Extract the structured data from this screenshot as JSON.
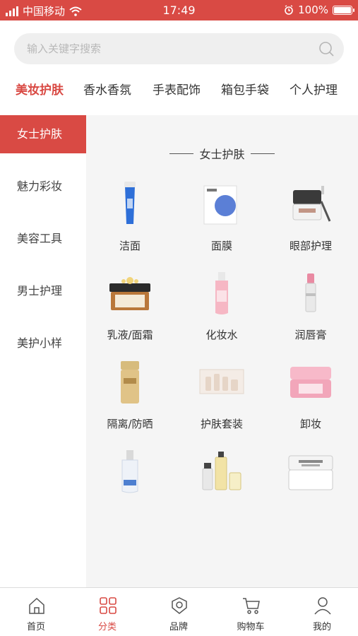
{
  "status_bar": {
    "carrier": "中国移动",
    "time": "17:49",
    "battery": "100%"
  },
  "search": {
    "placeholder": "输入关键字搜索"
  },
  "top_tabs": [
    {
      "label": "美妆护肤",
      "active": true
    },
    {
      "label": "香水香氛",
      "active": false
    },
    {
      "label": "手表配饰",
      "active": false
    },
    {
      "label": "箱包手袋",
      "active": false
    },
    {
      "label": "个人护理",
      "active": false
    }
  ],
  "sidebar": {
    "items": [
      {
        "label": "女士护肤",
        "active": true
      },
      {
        "label": "魅力彩妆",
        "active": false
      },
      {
        "label": "美容工具",
        "active": false
      },
      {
        "label": "男士护理",
        "active": false
      },
      {
        "label": "美护小样",
        "active": false
      }
    ]
  },
  "content": {
    "section_title": "女士护肤",
    "categories": [
      {
        "label": "洁面",
        "icon": "cleanser-tube-icon"
      },
      {
        "label": "面膜",
        "icon": "face-mask-icon"
      },
      {
        "label": "眼部护理",
        "icon": "eye-cream-jar-icon"
      },
      {
        "label": "乳液/面霜",
        "icon": "cream-jar-icon"
      },
      {
        "label": "化妆水",
        "icon": "toner-bottle-icon"
      },
      {
        "label": "润唇膏",
        "icon": "lip-balm-icon"
      },
      {
        "label": "隔离/防晒",
        "icon": "sunscreen-bottle-icon"
      },
      {
        "label": "护肤套装",
        "icon": "skincare-set-icon"
      },
      {
        "label": "卸妆",
        "icon": "makeup-remover-jar-icon"
      },
      {
        "label": "",
        "icon": "serum-bottle-icon"
      },
      {
        "label": "",
        "icon": "skincare-bottles-set-icon"
      },
      {
        "label": "",
        "icon": "face-cream-jar-icon"
      }
    ]
  },
  "bottom_nav": [
    {
      "label": "首页",
      "icon": "home-icon",
      "active": false
    },
    {
      "label": "分类",
      "icon": "category-grid-icon",
      "active": true
    },
    {
      "label": "品牌",
      "icon": "brand-badge-icon",
      "active": false
    },
    {
      "label": "购物车",
      "icon": "shopping-cart-icon",
      "active": false
    },
    {
      "label": "我的",
      "icon": "user-profile-icon",
      "active": false
    }
  ],
  "colors": {
    "accent": "#d94a44",
    "content_bg": "#f5f5f5"
  }
}
